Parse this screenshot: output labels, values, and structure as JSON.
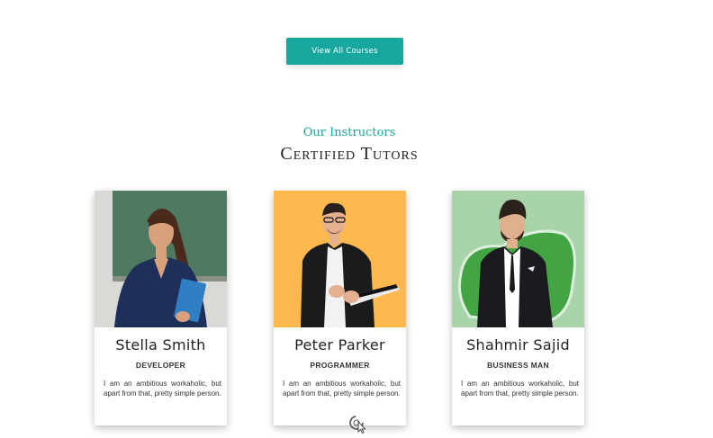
{
  "button": {
    "label": "View All Courses"
  },
  "section": {
    "kicker": "Our Instructors",
    "title": "Certified Tutors"
  },
  "instructors": [
    {
      "name": "Stella Smith",
      "role": "DEVELOPER",
      "bio": "I am an ambitious workaholic, but apart from that, pretty simple person.",
      "photo_bg": "#4f7a62"
    },
    {
      "name": "Peter Parker",
      "role": "PROGRAMMER",
      "bio": "I am an ambitious workaholic, but apart from that, pretty simple person.",
      "photo_bg": "#fdb94e"
    },
    {
      "name": "Shahmir Sajid",
      "role": "BUSINESS MAN",
      "bio": "I am an ambitious workaholic, but apart from that, pretty simple person.",
      "photo_bg": "#a9d3a8"
    }
  ],
  "colors": {
    "accent": "#16a79e"
  },
  "icons": {
    "cursor": "loading-cursor-icon"
  }
}
